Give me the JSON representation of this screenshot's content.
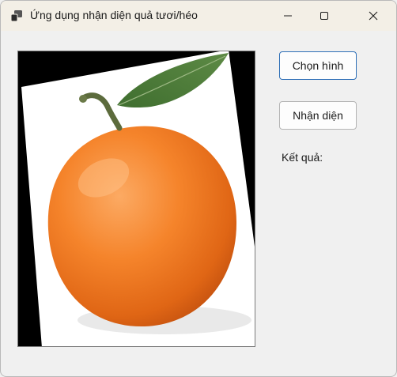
{
  "window": {
    "title": "Ứng dụng nhận diện quả tươi/héo",
    "app_icon": "windows-form-icon",
    "controls": [
      "minimize-icon",
      "maximize-icon",
      "close-icon"
    ]
  },
  "buttons": {
    "choose_image": "Chọn hình",
    "detect": "Nhận diện"
  },
  "result": {
    "label": "Kết quả:"
  },
  "colors": {
    "title_bar": "#f3efe6",
    "form_background": "#f0f0f0",
    "focused_button_border": "#2e6fb7",
    "orange": "#f5842b"
  }
}
